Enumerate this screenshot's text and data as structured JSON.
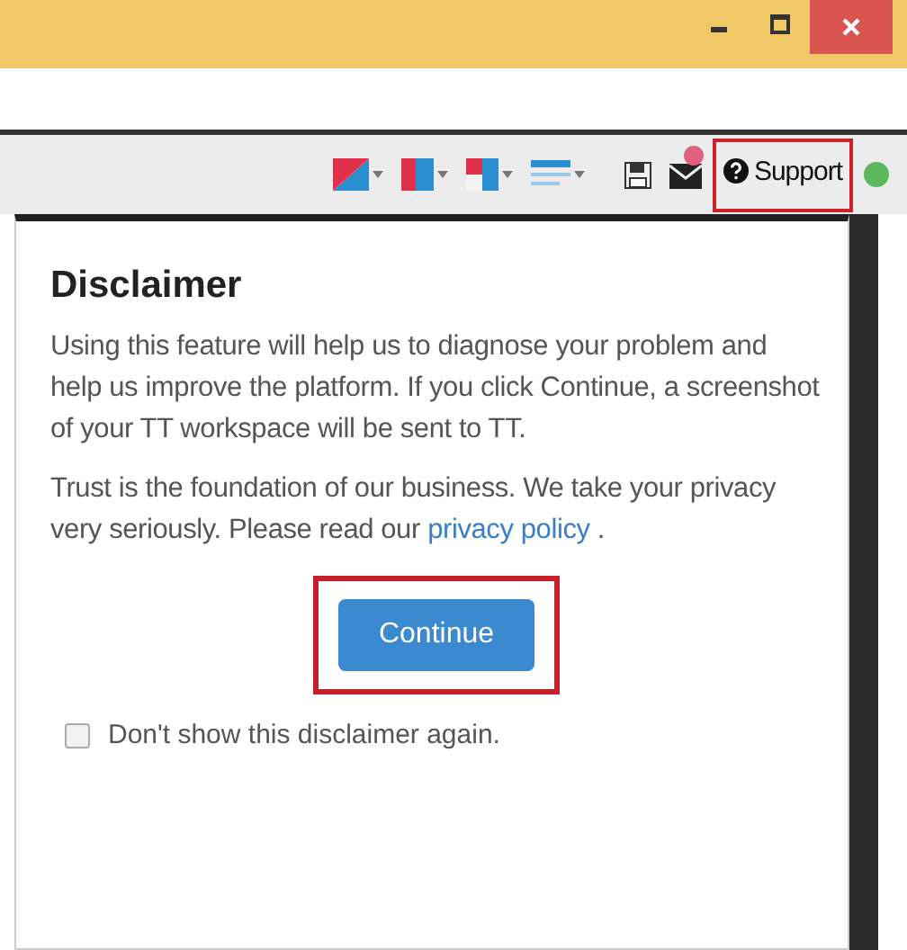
{
  "toolbar": {
    "format_buttons": [
      {
        "kind": "diagonal"
      },
      {
        "kind": "column"
      },
      {
        "kind": "corner"
      },
      {
        "kind": "lines"
      }
    ],
    "support": {
      "label": "Support",
      "highlighted": true
    },
    "status": {
      "color": "#5cb85c"
    }
  },
  "dialog": {
    "title": "Disclaimer",
    "paragraphs": [
      {
        "text": "Using this feature will help us to diagnose your problem and help us improve the platform. If you click Continue, a screenshot of your TT workspace will be sent to TT."
      },
      {
        "text": "Trust is the foundation of our business. We take your privacy very seriously. Please read our ",
        "link": "privacy policy",
        "after": " ."
      }
    ],
    "continue_button": {
      "label": "Continue",
      "highlighted": true
    },
    "dont_show": {
      "label": "Don't show this disclaimer again.",
      "checked": false
    }
  }
}
